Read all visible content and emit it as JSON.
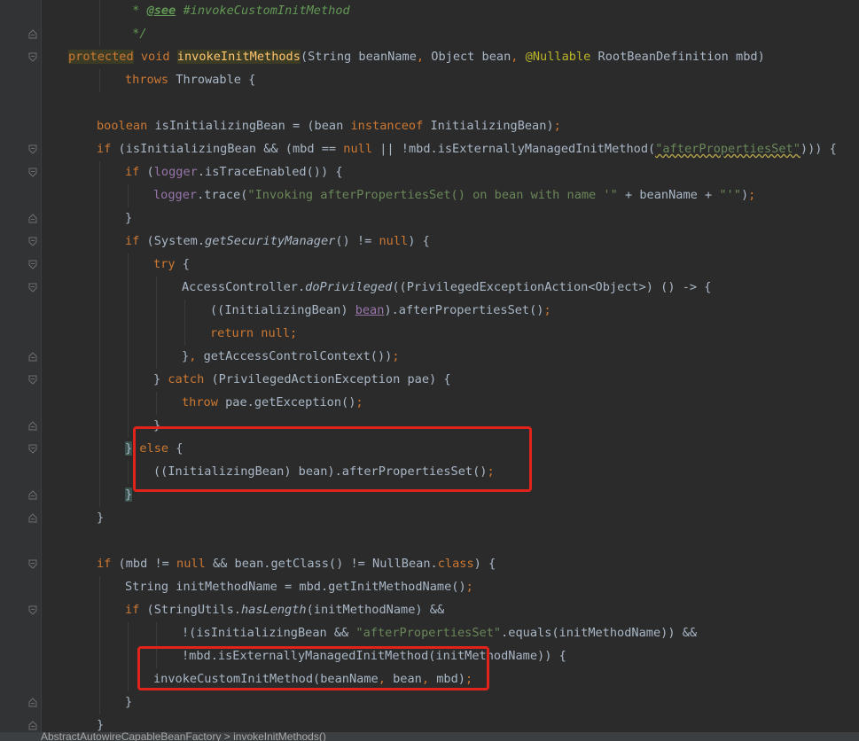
{
  "editor": {
    "theme_colors": {
      "background": "#2b2b2b",
      "gutter": "#313335",
      "default": "#a9b7c6",
      "keyword": "#cc7832",
      "method": "#ffc66d",
      "string": "#6a8759",
      "comment": "#629755",
      "annotation": "#bbb529",
      "field": "#9876aa",
      "highlight_box": "#e0231b"
    },
    "lines": [
      {
        "indent": 2,
        "fold": "none",
        "tokens": [
          {
            "t": " * ",
            "c": "comment"
          },
          {
            "t": "@see",
            "c": "comment-tag"
          },
          {
            "t": " #invokeCustomInitMethod",
            "c": "comment"
          }
        ]
      },
      {
        "indent": 2,
        "fold": "end",
        "tokens": [
          {
            "t": " */",
            "c": "comment"
          }
        ]
      },
      {
        "indent": 0,
        "fold": "start",
        "tokens": [
          {
            "t": "protected",
            "c": "keyword-hl"
          },
          {
            "t": " ",
            "c": "default"
          },
          {
            "t": "void",
            "c": "keyword"
          },
          {
            "t": " ",
            "c": "default"
          },
          {
            "t": "invokeInitMethods",
            "c": "method-hl"
          },
          {
            "t": "(String beanName",
            "c": "default"
          },
          {
            "t": ", ",
            "c": "keyword"
          },
          {
            "t": "Object bean",
            "c": "default"
          },
          {
            "t": ", ",
            "c": "keyword"
          },
          {
            "t": "@Nullable",
            "c": "annotation"
          },
          {
            "t": " RootBeanDefinition mbd)",
            "c": "default"
          }
        ]
      },
      {
        "indent": 2,
        "fold": "none",
        "tokens": [
          {
            "t": "throws",
            "c": "keyword"
          },
          {
            "t": " Throwable {",
            "c": "default"
          }
        ]
      },
      {
        "indent": 1,
        "fold": "none",
        "tokens": []
      },
      {
        "indent": 1,
        "fold": "none",
        "tokens": [
          {
            "t": "boolean",
            "c": "keyword"
          },
          {
            "t": " isInitializingBean = (bean ",
            "c": "default"
          },
          {
            "t": "instanceof",
            "c": "keyword"
          },
          {
            "t": " InitializingBean)",
            "c": "default"
          },
          {
            "t": ";",
            "c": "keyword"
          }
        ]
      },
      {
        "indent": 1,
        "fold": "start",
        "tokens": [
          {
            "t": "if",
            "c": "keyword"
          },
          {
            "t": " (isInitializingBean && (mbd == ",
            "c": "default"
          },
          {
            "t": "null",
            "c": "keyword"
          },
          {
            "t": " || !mbd.isExternallyManagedInitMethod(",
            "c": "default"
          },
          {
            "t": "\"afterPropertiesSet\"",
            "c": "string-wavy"
          },
          {
            "t": "))) {",
            "c": "default"
          }
        ]
      },
      {
        "indent": 2,
        "fold": "start",
        "tokens": [
          {
            "t": "if",
            "c": "keyword"
          },
          {
            "t": " (",
            "c": "default"
          },
          {
            "t": "logger",
            "c": "field"
          },
          {
            "t": ".isTraceEnabled()) {",
            "c": "default"
          }
        ]
      },
      {
        "indent": 3,
        "fold": "none",
        "tokens": [
          {
            "t": "logger",
            "c": "field"
          },
          {
            "t": ".trace(",
            "c": "default"
          },
          {
            "t": "\"Invoking afterPropertiesSet() on bean with name '\"",
            "c": "string"
          },
          {
            "t": " + beanName + ",
            "c": "default"
          },
          {
            "t": "\"'\"",
            "c": "string"
          },
          {
            "t": ")",
            "c": "default"
          },
          {
            "t": ";",
            "c": "keyword"
          }
        ]
      },
      {
        "indent": 2,
        "fold": "end",
        "tokens": [
          {
            "t": "}",
            "c": "default"
          }
        ]
      },
      {
        "indent": 2,
        "fold": "start",
        "tokens": [
          {
            "t": "if",
            "c": "keyword"
          },
          {
            "t": " (System.",
            "c": "default"
          },
          {
            "t": "getSecurityManager",
            "c": "italic"
          },
          {
            "t": "() != ",
            "c": "default"
          },
          {
            "t": "null",
            "c": "keyword"
          },
          {
            "t": ") {",
            "c": "default"
          }
        ]
      },
      {
        "indent": 3,
        "fold": "start",
        "tokens": [
          {
            "t": "try",
            "c": "keyword"
          },
          {
            "t": " {",
            "c": "default"
          }
        ]
      },
      {
        "indent": 4,
        "fold": "start",
        "tokens": [
          {
            "t": "AccessController.",
            "c": "default"
          },
          {
            "t": "doPrivileged",
            "c": "italic"
          },
          {
            "t": "((PrivilegedExceptionAction<Object>) () -> {",
            "c": "default"
          }
        ]
      },
      {
        "indent": 5,
        "fold": "none",
        "tokens": [
          {
            "t": "((InitializingBean) ",
            "c": "default"
          },
          {
            "t": "bean",
            "c": "field-underline"
          },
          {
            "t": ").afterPropertiesSet()",
            "c": "default"
          },
          {
            "t": ";",
            "c": "keyword"
          }
        ]
      },
      {
        "indent": 5,
        "fold": "none",
        "tokens": [
          {
            "t": "return",
            "c": "keyword"
          },
          {
            "t": " ",
            "c": "default"
          },
          {
            "t": "null",
            "c": "keyword"
          },
          {
            "t": ";",
            "c": "keyword"
          }
        ]
      },
      {
        "indent": 4,
        "fold": "end",
        "tokens": [
          {
            "t": "}",
            "c": "default"
          },
          {
            "t": ", ",
            "c": "keyword"
          },
          {
            "t": "getAccessControlContext())",
            "c": "default"
          },
          {
            "t": ";",
            "c": "keyword"
          }
        ]
      },
      {
        "indent": 3,
        "fold": "start",
        "tokens": [
          {
            "t": "} ",
            "c": "default"
          },
          {
            "t": "catch",
            "c": "keyword"
          },
          {
            "t": " (PrivilegedActionException pae) {",
            "c": "default"
          }
        ]
      },
      {
        "indent": 4,
        "fold": "none",
        "tokens": [
          {
            "t": "throw",
            "c": "keyword"
          },
          {
            "t": " pae.getException()",
            "c": "default"
          },
          {
            "t": ";",
            "c": "keyword"
          }
        ]
      },
      {
        "indent": 3,
        "fold": "end",
        "tokens": [
          {
            "t": "}",
            "c": "default"
          }
        ]
      },
      {
        "indent": 2,
        "fold": "start",
        "tokens": [
          {
            "t": "}",
            "c": "brace-hl"
          },
          {
            "t": " ",
            "c": "default"
          },
          {
            "t": "else",
            "c": "keyword"
          },
          {
            "t": " {",
            "c": "default"
          }
        ]
      },
      {
        "indent": 3,
        "fold": "none",
        "tokens": [
          {
            "t": "((InitializingBean) bean).afterPropertiesSet()",
            "c": "default"
          },
          {
            "t": ";",
            "c": "keyword"
          }
        ]
      },
      {
        "indent": 2,
        "fold": "end",
        "tokens": [
          {
            "t": "}",
            "c": "brace-hl"
          }
        ]
      },
      {
        "indent": 1,
        "fold": "end",
        "tokens": [
          {
            "t": "}",
            "c": "default"
          }
        ]
      },
      {
        "indent": 1,
        "fold": "none",
        "tokens": []
      },
      {
        "indent": 1,
        "fold": "start",
        "tokens": [
          {
            "t": "if",
            "c": "keyword"
          },
          {
            "t": " (mbd != ",
            "c": "default"
          },
          {
            "t": "null",
            "c": "keyword"
          },
          {
            "t": " && bean.getClass() != NullBean.",
            "c": "default"
          },
          {
            "t": "class",
            "c": "keyword"
          },
          {
            "t": ") {",
            "c": "default"
          }
        ]
      },
      {
        "indent": 2,
        "fold": "none",
        "tokens": [
          {
            "t": "String initMethodName = mbd.getInitMethodName()",
            "c": "default"
          },
          {
            "t": ";",
            "c": "keyword"
          }
        ]
      },
      {
        "indent": 2,
        "fold": "start",
        "tokens": [
          {
            "t": "if",
            "c": "keyword"
          },
          {
            "t": " (StringUtils.",
            "c": "default"
          },
          {
            "t": "hasLength",
            "c": "italic"
          },
          {
            "t": "(initMethodName) &&",
            "c": "default"
          }
        ]
      },
      {
        "indent": 4,
        "fold": "none",
        "tokens": [
          {
            "t": "!(isInitializingBean && ",
            "c": "default"
          },
          {
            "t": "\"afterPropertiesSet\"",
            "c": "string"
          },
          {
            "t": ".equals(initMethodName)) &&",
            "c": "default"
          }
        ]
      },
      {
        "indent": 4,
        "fold": "none",
        "tokens": [
          {
            "t": "!mbd.isExternallyManagedInitMethod(initMethodName)) {",
            "c": "default"
          }
        ]
      },
      {
        "indent": 3,
        "fold": "none",
        "tokens": [
          {
            "t": "invokeCustomInitMethod(beanName",
            "c": "default"
          },
          {
            "t": ", ",
            "c": "keyword"
          },
          {
            "t": "bean",
            "c": "default"
          },
          {
            "t": ", ",
            "c": "keyword"
          },
          {
            "t": "mbd)",
            "c": "default"
          },
          {
            "t": ";",
            "c": "keyword"
          }
        ]
      },
      {
        "indent": 2,
        "fold": "end",
        "tokens": [
          {
            "t": "}",
            "c": "default"
          }
        ]
      },
      {
        "indent": 1,
        "fold": "end",
        "tokens": [
          {
            "t": "}",
            "c": "default"
          }
        ]
      }
    ]
  },
  "status_bar": {
    "breadcrumb": "AbstractAutowireCapableBeanFactory > invokeInitMethods()"
  }
}
